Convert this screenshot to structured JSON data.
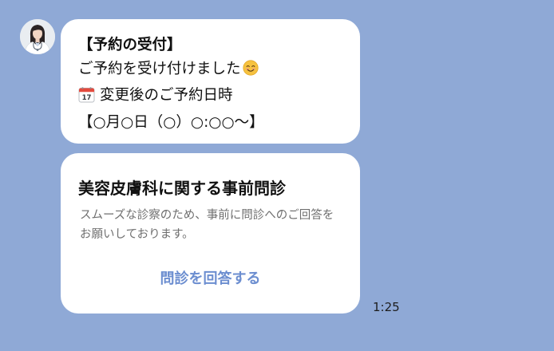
{
  "chat": {
    "messages": [
      {
        "lines": [
          "【予約の受付】",
          "ご予約を受け付けました",
          "変更後のご予約日時",
          "【○月○日（○）○:○○〜】"
        ]
      }
    ],
    "card": {
      "title": "美容皮膚科に関する事前問診",
      "description": "スムーズな診察のため、事前に問診へのご回答をお願いしております。",
      "action_label": "問診を回答する"
    },
    "timestamp": "1:25"
  },
  "colors": {
    "background": "#8fa9d6",
    "bubble": "#ffffff",
    "action_link": "#6c8ed0"
  },
  "icons": {
    "avatar": "doctor-avatar-icon",
    "smile": "smiling-face-emoji-icon",
    "calendar": "calendar-17-emoji-icon"
  }
}
